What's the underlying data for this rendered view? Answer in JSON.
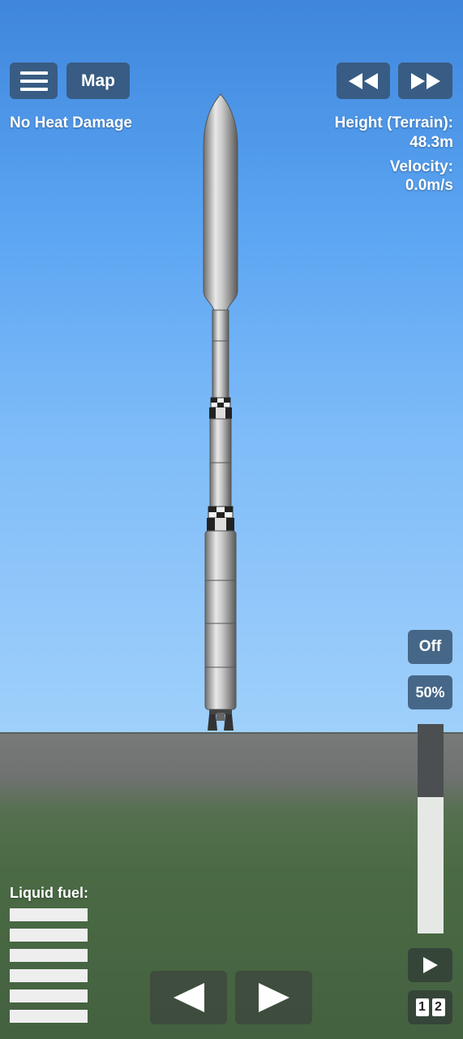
{
  "hud": {
    "menu_icon": "hamburger-menu-icon",
    "map_label": "Map",
    "rewind_icon": "rewind-icon",
    "fast_forward_icon": "fast-forward-icon",
    "heat_status": "No Heat Damage",
    "height_label": "Height (Terrain):",
    "height_value": "48.3m",
    "velocity_label": "Velocity:",
    "velocity_value": "0.0m/s"
  },
  "controls": {
    "engine_toggle_label": "Off",
    "throttle_label": "50%",
    "throttle_level": 0.65,
    "play_icon": "play-icon",
    "stage_digits": [
      "1",
      "2"
    ],
    "rotate_left_icon": "rotate-left-arrow-icon",
    "rotate_right_icon": "rotate-right-arrow-icon"
  },
  "fuel": {
    "label": "Liquid fuel:",
    "bars": 6
  },
  "colors": {
    "sky_top": "#3f86dc",
    "sky_bottom": "#9fd0fb",
    "ground": "#4a6a44",
    "button_bg": "#35506e",
    "throttle_empty": "#e6e8e6",
    "throttle_filled": "#4b4f52"
  }
}
